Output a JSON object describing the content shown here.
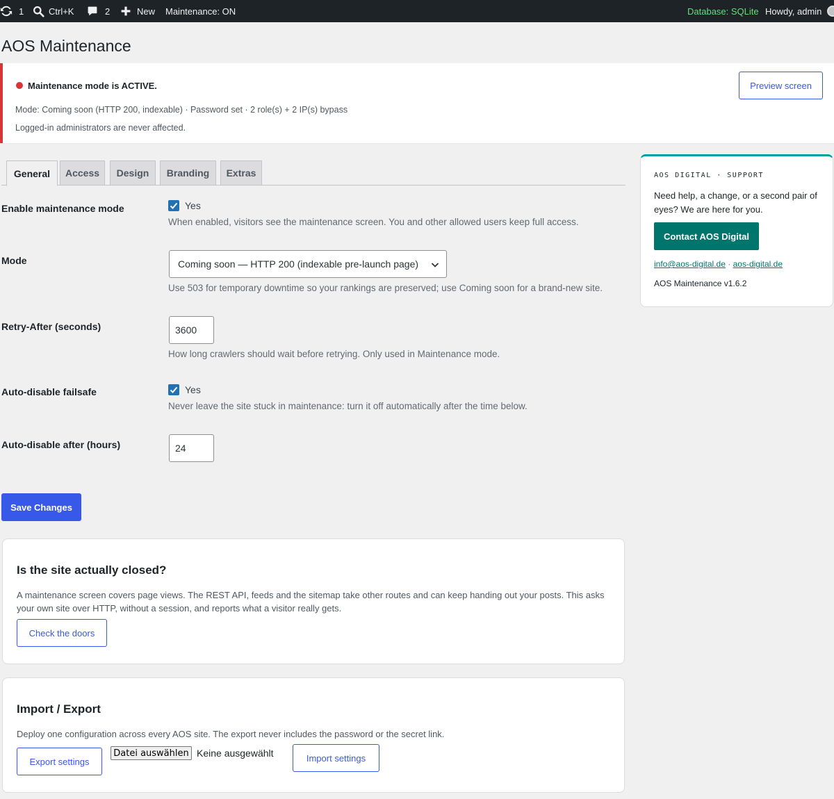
{
  "adminbar": {
    "updates_count": "1",
    "search_shortcut": "Ctrl+K",
    "comments_count": "2",
    "new_label": "New",
    "maintenance_label": "Maintenance: ON",
    "database_label": "Database: SQLite",
    "howdy_label": "Howdy, admin"
  },
  "page": {
    "title": "AOS Maintenance"
  },
  "notice": {
    "heading": "Maintenance mode is ACTIVE.",
    "line1": "Mode: Coming soon (HTTP 200, indexable) · Password set · 2 role(s) + 2 IP(s) bypass",
    "line2": "Logged-in administrators are never affected.",
    "preview_label": "Preview screen"
  },
  "tabs": [
    {
      "label": "General",
      "active": true
    },
    {
      "label": "Access",
      "active": false
    },
    {
      "label": "Design",
      "active": false
    },
    {
      "label": "Branding",
      "active": false
    },
    {
      "label": "Extras",
      "active": false
    }
  ],
  "form": {
    "enable": {
      "label": "Enable maintenance mode",
      "checkbox_label": "Yes",
      "checked": true,
      "description": "When enabled, visitors see the maintenance screen. You and other allowed users keep full access."
    },
    "mode": {
      "label": "Mode",
      "value": "Coming soon — HTTP 200 (indexable pre-launch page)",
      "description": "Use 503 for temporary downtime so your rankings are preserved; use Coming soon for a brand-new site."
    },
    "retry": {
      "label": "Retry-After (seconds)",
      "value": "3600",
      "description": "How long crawlers should wait before retrying. Only used in Maintenance mode."
    },
    "failsafe": {
      "label": "Auto-disable failsafe",
      "checkbox_label": "Yes",
      "checked": true,
      "description": "Never leave the site stuck in maintenance: turn it off automatically after the time below."
    },
    "hours": {
      "label": "Auto-disable after (hours)",
      "value": "24"
    },
    "save_label": "Save Changes"
  },
  "closed_card": {
    "title": "Is the site actually closed?",
    "text": "A maintenance screen covers page views. The REST API, feeds and the sitemap take other routes and can keep handing out your posts. This asks your own site over HTTP, without a session, and reports what a visitor really gets.",
    "button_label": "Check the doors"
  },
  "import_card": {
    "title": "Import / Export",
    "text": "Deploy one configuration across every AOS site. The export never includes the password or the secret link.",
    "export_label": "Export settings",
    "file_button_label": "Datei auswählen",
    "file_none_label": "Keine ausgewählt",
    "import_label": "Import settings"
  },
  "support": {
    "eyebrow": "AOS DIGITAL · SUPPORT",
    "text": "Need help, a change, or a second pair of eyes? We are here for you.",
    "contact_label": "Contact AOS Digital",
    "email": "info@aos-digital.de",
    "separator": "·",
    "website": "aos-digital.de",
    "version": "AOS Maintenance v1.6.2"
  },
  "colors": {
    "accent_blue": "#3858e9",
    "wp_blue": "#2271b1",
    "notice_red": "#d63638",
    "teal": "#00756b",
    "db_green": "#68de7c"
  }
}
